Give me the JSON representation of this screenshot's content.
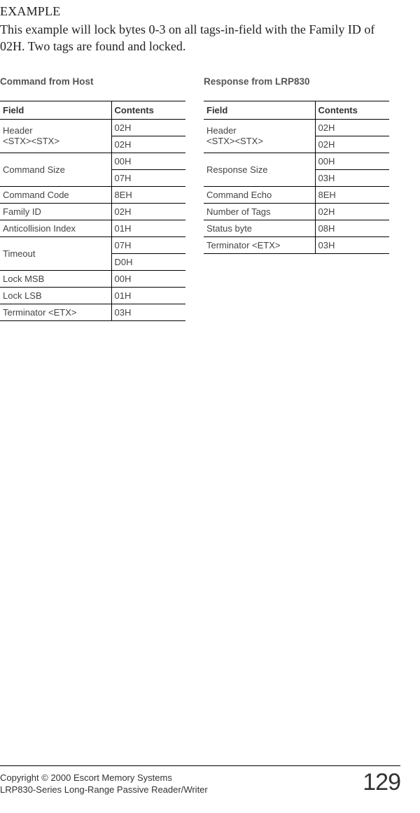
{
  "heading": "EXAMPLE",
  "intro": "This example will lock bytes 0-3 on all tags-in-field with the Family ID of 02H. Two tags are found and locked.",
  "left": {
    "title": "Command from Host",
    "header_field": "Field",
    "header_contents": "Contents",
    "rows": [
      {
        "field": "Header\n<STX><STX>",
        "contents": "02H",
        "span": 2,
        "sub": [
          "02H"
        ]
      },
      {
        "field": "Command Size",
        "contents": "00H",
        "span": 2,
        "sub": [
          "07H"
        ]
      },
      {
        "field": "Command Code",
        "contents": "8EH"
      },
      {
        "field": "Family ID",
        "contents": "02H"
      },
      {
        "field": "Anticollision Index",
        "contents": "01H"
      },
      {
        "field": "Timeout",
        "contents": "07H",
        "span": 2,
        "sub": [
          "D0H"
        ]
      },
      {
        "field": "Lock MSB",
        "contents": "00H"
      },
      {
        "field": "Lock LSB",
        "contents": "01H"
      },
      {
        "field": "Terminator <ETX>",
        "contents": "03H"
      }
    ]
  },
  "right": {
    "title": "Response from LRP830",
    "header_field": "Field",
    "header_contents": "Contents",
    "rows": [
      {
        "field": "Header\n<STX><STX>",
        "contents": "02H",
        "span": 2,
        "sub": [
          "02H"
        ]
      },
      {
        "field": "Response Size",
        "contents": "00H",
        "span": 2,
        "sub": [
          "03H"
        ]
      },
      {
        "field": "Command Echo",
        "contents": "8EH"
      },
      {
        "field": "Number of Tags",
        "contents": "02H"
      },
      {
        "field": "Status byte",
        "contents": "08H"
      },
      {
        "field": "Terminator <ETX>",
        "contents": "03H"
      }
    ]
  },
  "footer": {
    "line1": "Copyright © 2000 Escort Memory Systems",
    "line2": "LRP830-Series Long-Range Passive Reader/Writer",
    "page": "129"
  }
}
